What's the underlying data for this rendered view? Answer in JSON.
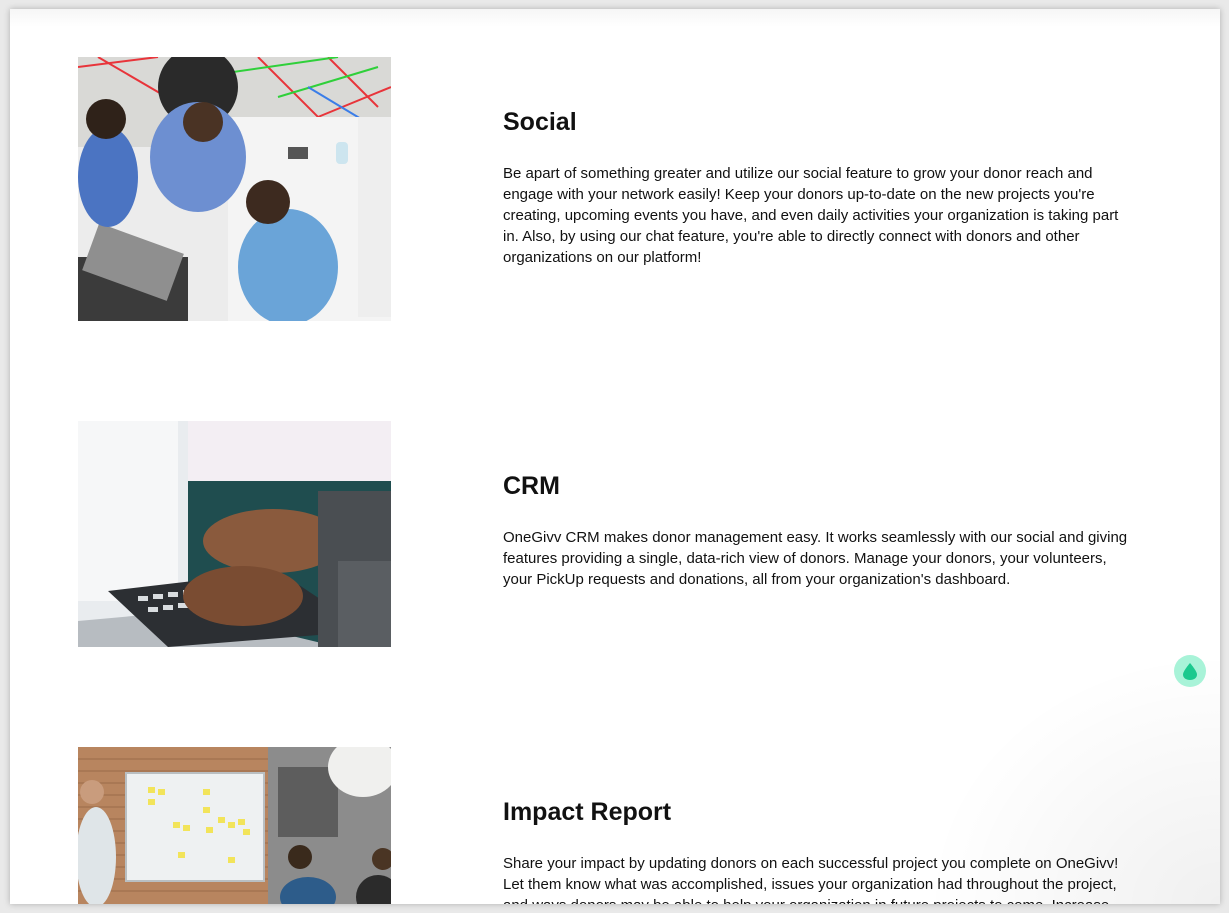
{
  "features": [
    {
      "title": "Social",
      "description": "Be apart of something greater and utilize our social feature to grow your donor reach and engage with your network easily! Keep your donors up-to-date on the new projects you're creating, upcoming events you have, and even daily activities your organization is taking part in. Also, by using our chat feature, you're able to directly connect with donors and other organizations on our platform!",
      "image": "team-meeting-photo"
    },
    {
      "title": "CRM",
      "description": "OneGivv CRM makes donor management easy. It works seamlessly with our social and giving features providing a single, data-rich view of donors. Manage your donors, your volunteers, your PickUp requests and donations, all from your organization's dashboard.",
      "image": "laptop-typing-photo"
    },
    {
      "title": "Impact Report",
      "description": "Share your impact by updating donors on each successful project you complete on OneGivv! Let them know what was accomplished, issues your organization had throughout the project, and ways donors may be able to help your organization in future projects to come. Increase",
      "image": "whiteboard-presentation-photo"
    }
  ],
  "chat_widget": {
    "icon": "chat-drop-icon",
    "color": "#1bc98e"
  }
}
